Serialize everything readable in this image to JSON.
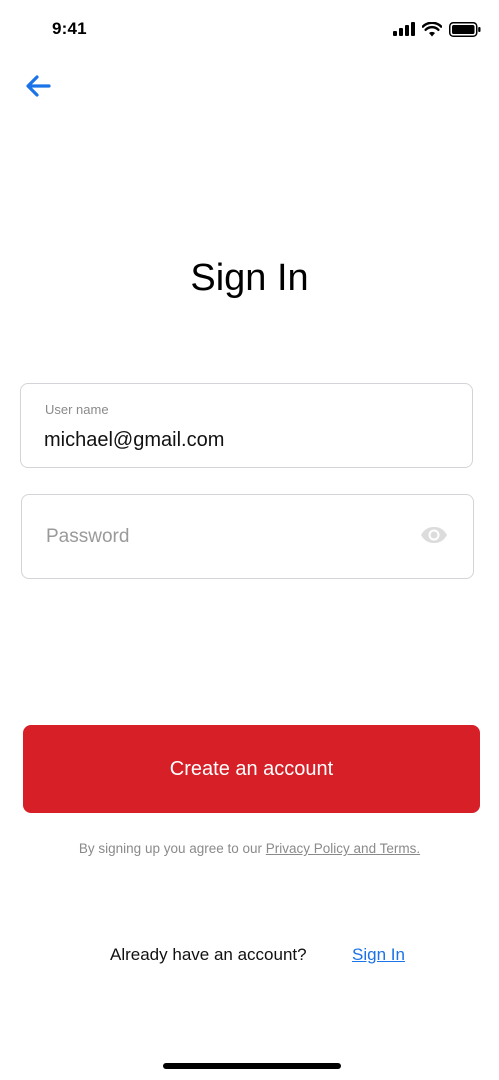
{
  "status_bar": {
    "time": "9:41",
    "icons": [
      "signal-icon",
      "wifi-icon",
      "battery-icon"
    ]
  },
  "nav": {
    "back_icon": "arrow-left-icon",
    "accent_color": "#1a73e8"
  },
  "page": {
    "title": "Sign In"
  },
  "form": {
    "username": {
      "label": "User name",
      "value": "michael@gmail.com"
    },
    "password": {
      "placeholder": "Password",
      "toggle_icon": "eye-icon"
    }
  },
  "primary_action": {
    "label": "Create an account",
    "color": "#d71f27"
  },
  "terms": {
    "prefix": "By signing up you agree to our ",
    "link_label": "Privacy Policy and Terms."
  },
  "footer": {
    "prompt": "Already have an account?",
    "signin_label": "Sign In"
  }
}
